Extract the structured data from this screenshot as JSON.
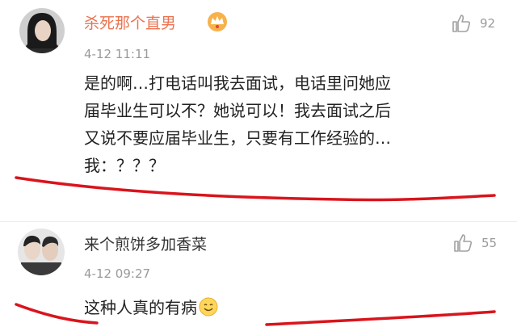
{
  "comments": [
    {
      "username": "杀死那个直男",
      "time": "4-12 11:11",
      "likes": "92",
      "lines": [
        "是的啊…打电话叫我去面试，电话里问她应",
        "届毕业生可以不？她说可以！我去面试之后",
        "又说不要应届毕业生，只要有工作经验的…",
        "我：？？？"
      ],
      "badge_icon": "crown-badge-icon"
    },
    {
      "username": "来个煎饼多加香菜",
      "time": "4-12 09:27",
      "likes": "55",
      "lines": [
        "这种人真的有病"
      ],
      "trailing_icon": "smile-emoji-icon"
    }
  ],
  "colors": {
    "username_highlight": "#eb7350",
    "annotation_red": "#d9141c",
    "meta_gray": "#9a9a9a"
  }
}
